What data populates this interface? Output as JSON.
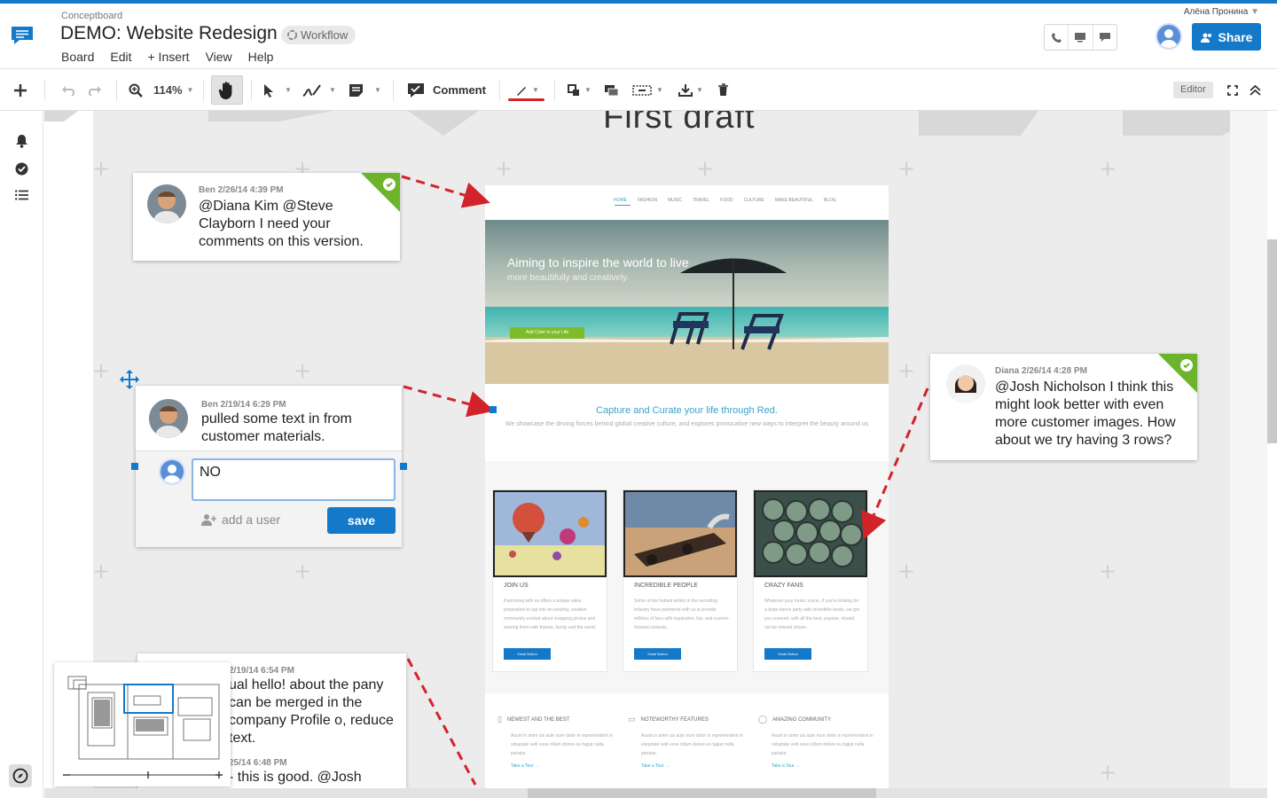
{
  "header": {
    "company": "Conceptboard",
    "board_title": "DEMO: Website Redesign",
    "workflow_label": "Workflow",
    "menu": [
      "Board",
      "Edit",
      "+ Insert",
      "View",
      "Help"
    ],
    "user_name": "Алёна Пронина",
    "share_label": "Share"
  },
  "toolbar": {
    "zoom": "114%",
    "comment_label": "Comment",
    "mode_badge": "Editor"
  },
  "board": {
    "title": "First draft"
  },
  "comments": [
    {
      "meta": "Ben 2/26/14 4:39 PM",
      "text": "@Diana Kim @Steve Clayborn I need your comments on this version.",
      "resolved": true
    },
    {
      "meta": "Ben 2/19/14 6:29 PM",
      "text": "pulled some text in from customer materials.",
      "reply_value": "NO",
      "add_user_label": "add a user",
      "save_label": "save"
    },
    {
      "meta": "Diana 2/26/14 4:28 PM",
      "text": "@Josh Nicholson I think this might look better with even more customer images. How about we try having 3 rows?",
      "resolved": true
    },
    {
      "meta": "2/19/14 6:54 PM",
      "text": "ual hello! about the pany can be merged in the company Profile o, reduce text.",
      "meta2": "25/14 6:48 PM",
      "text2": "- this is good. @Josh"
    }
  ],
  "mockup": {
    "nav": [
      "HOME",
      "FASHION",
      "MUSIC",
      "TRAVEL",
      "FOOD",
      "CULTURE",
      "MAKE BEAUTIFUL",
      "BLOG"
    ],
    "hero_title": "Aiming to inspire the world to live",
    "hero_sub": "more beautifully and creatively.",
    "hero_btn": "Add Color to your Life",
    "tagline": "Capture and Curate your life through Red.",
    "tagdesc": "We showcase the driving forces behind global creative culture, and explores provocative new ways to interpret the beauty around us",
    "cards": [
      {
        "title": "JOIN US",
        "desc": "Partnering with us offers a unique value proposition to tap into an existing, creative community excited about snapping photos and sharing them with friends, family and the world.",
        "btn": "Small Button"
      },
      {
        "title": "INCREDIBLE PEOPLE",
        "desc": "Some of the hottest artists in the recording industry have partnered with us to provide millions of fans with inspiration, fun, and custom-themed contests.",
        "btn": "Small Button"
      },
      {
        "title": "CRAZY FANS",
        "desc": "Whatever your music scene, if you're looking for a dope dance party with incredible beats, we got you covered, with all the best, popular, should not be missed shows.",
        "btn": "Small Button"
      }
    ],
    "features": [
      {
        "title": "NEWEST AND THE BEST",
        "desc": "Asunt in anim uis aute irure dolor in reprehenderit in voluptate velit esse cillum dolore eu fugiat nulla pariatur.",
        "link": "Take a Tour →"
      },
      {
        "title": "NOTEWORTHY FEATURES",
        "desc": "Asunt in anim uis aute irure dolor in reprehenderit in voluptate velit esse cillum dolore eu fugiat nulla pariatur.",
        "link": "Take a Tour →"
      },
      {
        "title": "AMAZING COMMUNITY",
        "desc": "Asunt in anim uis aute irure dolor in reprehenderit in voluptate velit esse cillum dolore eu fugiat nulla pariatur.",
        "link": "Take a Tour →"
      }
    ]
  },
  "colors": {
    "accent": "#1479c9",
    "resolved": "#6cb42b",
    "arrow": "#d2232a"
  },
  "icons": [
    "app-logo-icon",
    "workflow-icon",
    "phone-icon",
    "screen-icon",
    "chat-icon",
    "user-avatar-icon",
    "add-icon",
    "undo-icon",
    "redo-icon",
    "zoom-icon",
    "hand-icon",
    "pointer-icon",
    "pen-icon",
    "sticky-note-icon",
    "comment-icon",
    "stroke-icon",
    "transform-icon",
    "layers-icon",
    "link-icon",
    "download-icon",
    "trash-icon",
    "fullscreen-icon",
    "collapse-icon",
    "bell-icon",
    "check-icon",
    "list-icon",
    "compass-icon",
    "move-icon"
  ]
}
